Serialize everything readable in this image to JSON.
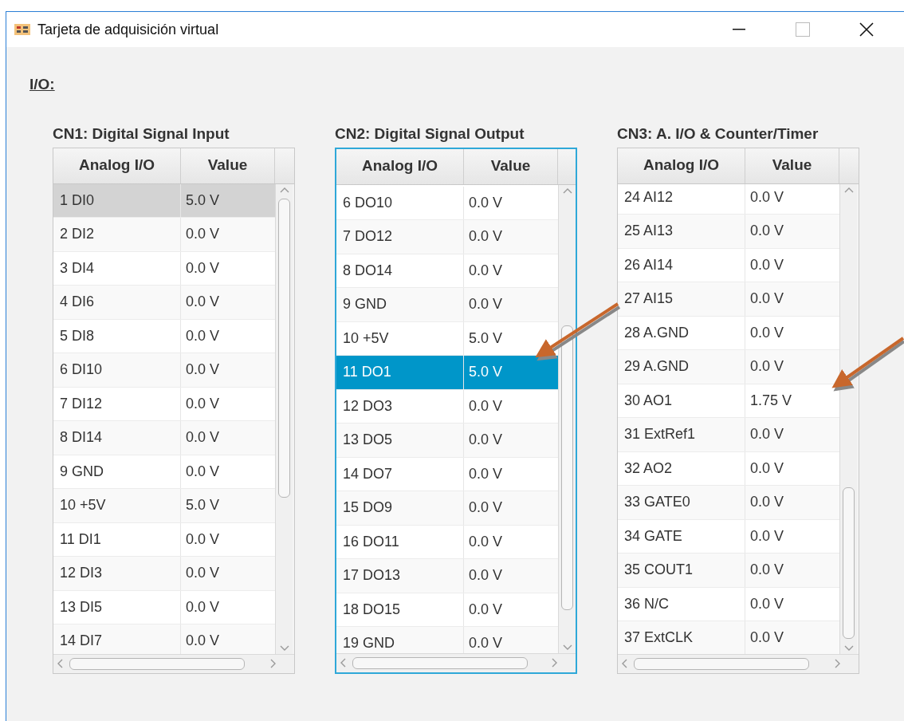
{
  "window": {
    "title": "Tarjeta de adquisición virtual"
  },
  "section_label": "I/O:",
  "tables": [
    {
      "title": "CN1: Digital Signal Input",
      "focused": false,
      "columns": [
        "Analog I/O",
        "Value"
      ],
      "rows": [
        {
          "cells": [
            "1 DI0",
            "5.0 V"
          ],
          "selected": true
        },
        {
          "cells": [
            "2 DI2",
            "0.0 V"
          ],
          "selected": false
        },
        {
          "cells": [
            "3 DI4",
            "0.0 V"
          ],
          "selected": false
        },
        {
          "cells": [
            "4 DI6",
            "0.0 V"
          ],
          "selected": false
        },
        {
          "cells": [
            "5 DI8",
            "0.0 V"
          ],
          "selected": false
        },
        {
          "cells": [
            "6 DI10",
            "0.0 V"
          ],
          "selected": false
        },
        {
          "cells": [
            "7 DI12",
            "0.0 V"
          ],
          "selected": false
        },
        {
          "cells": [
            "8 DI14",
            "0.0 V"
          ],
          "selected": false
        },
        {
          "cells": [
            "9 GND",
            "0.0 V"
          ],
          "selected": false
        },
        {
          "cells": [
            "10 +5V",
            "5.0 V"
          ],
          "selected": false
        },
        {
          "cells": [
            "11 DI1",
            "0.0 V"
          ],
          "selected": false
        },
        {
          "cells": [
            "12 DI3",
            "0.0 V"
          ],
          "selected": false
        },
        {
          "cells": [
            "13 DI5",
            "0.0 V"
          ],
          "selected": false
        },
        {
          "cells": [
            "14 DI7",
            "0.0 V"
          ],
          "selected": false
        }
      ]
    },
    {
      "title": "CN2: Digital Signal Output",
      "focused": true,
      "columns": [
        "Analog I/O",
        "Value"
      ],
      "rows": [
        {
          "cells": [
            "6 DO10",
            "0.0 V"
          ],
          "selected": false
        },
        {
          "cells": [
            "7 DO12",
            "0.0 V"
          ],
          "selected": false
        },
        {
          "cells": [
            "8 DO14",
            "0.0 V"
          ],
          "selected": false
        },
        {
          "cells": [
            "9 GND",
            "0.0 V"
          ],
          "selected": false
        },
        {
          "cells": [
            "10 +5V",
            "5.0 V"
          ],
          "selected": false
        },
        {
          "cells": [
            "11 DO1",
            "5.0 V"
          ],
          "selected": true
        },
        {
          "cells": [
            "12 DO3",
            "0.0 V"
          ],
          "selected": false
        },
        {
          "cells": [
            "13 DO5",
            "0.0 V"
          ],
          "selected": false
        },
        {
          "cells": [
            "14 DO7",
            "0.0 V"
          ],
          "selected": false
        },
        {
          "cells": [
            "15 DO9",
            "0.0 V"
          ],
          "selected": false
        },
        {
          "cells": [
            "16 DO11",
            "0.0 V"
          ],
          "selected": false
        },
        {
          "cells": [
            "17 DO13",
            "0.0 V"
          ],
          "selected": false
        },
        {
          "cells": [
            "18 DO15",
            "0.0 V"
          ],
          "selected": false
        },
        {
          "cells": [
            "19 GND",
            "0.0 V"
          ],
          "selected": false
        }
      ]
    },
    {
      "title": "CN3: A. I/O & Counter/Timer",
      "focused": false,
      "columns": [
        "Analog I/O",
        "Value"
      ],
      "rows": [
        {
          "cells": [
            "24 AI12",
            "0.0 V"
          ],
          "selected": false
        },
        {
          "cells": [
            "25 AI13",
            "0.0 V"
          ],
          "selected": false
        },
        {
          "cells": [
            "26 AI14",
            "0.0 V"
          ],
          "selected": false
        },
        {
          "cells": [
            "27 AI15",
            "0.0 V"
          ],
          "selected": false
        },
        {
          "cells": [
            "28 A.GND",
            "0.0 V"
          ],
          "selected": false
        },
        {
          "cells": [
            "29 A.GND",
            "0.0 V"
          ],
          "selected": false
        },
        {
          "cells": [
            "30 AO1",
            "1.75 V"
          ],
          "selected": false
        },
        {
          "cells": [
            "31 ExtRef1",
            "0.0 V"
          ],
          "selected": false
        },
        {
          "cells": [
            "32 AO2",
            "0.0 V"
          ],
          "selected": false
        },
        {
          "cells": [
            "33 GATE0",
            "0.0 V"
          ],
          "selected": false
        },
        {
          "cells": [
            "34 GATE",
            "0.0 V"
          ],
          "selected": false
        },
        {
          "cells": [
            "35 COUT1",
            "0.0 V"
          ],
          "selected": false
        },
        {
          "cells": [
            "36 N/C",
            "0.0 V"
          ],
          "selected": false
        },
        {
          "cells": [
            "37 ExtCLK",
            "0.0 V"
          ],
          "selected": false
        }
      ]
    }
  ]
}
